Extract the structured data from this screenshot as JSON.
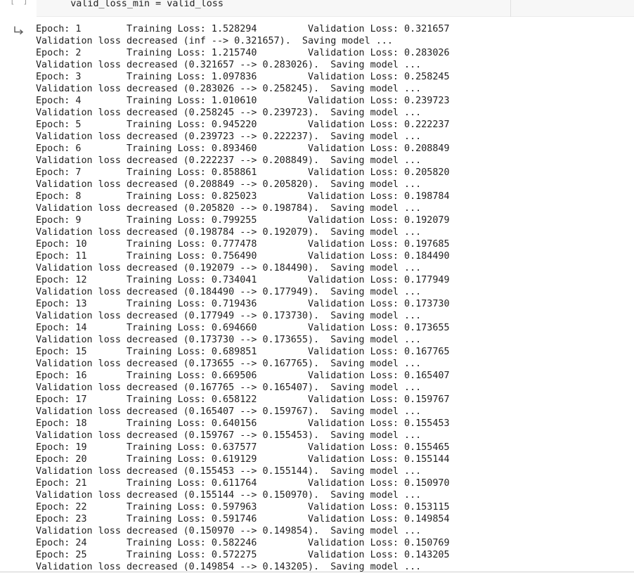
{
  "code_cell": {
    "prompt": "[ ]",
    "code_line": "    valid_loss_min = valid_loss"
  },
  "output": {
    "icon": "output-arrow-icon",
    "lines": [
      "Epoch: 1 \tTraining Loss: 1.528294 \tValidation Loss: 0.321657",
      "Validation loss decreased (inf --> 0.321657).  Saving model ...",
      "Epoch: 2 \tTraining Loss: 1.215740 \tValidation Loss: 0.283026",
      "Validation loss decreased (0.321657 --> 0.283026).  Saving model ...",
      "Epoch: 3 \tTraining Loss: 1.097836 \tValidation Loss: 0.258245",
      "Validation loss decreased (0.283026 --> 0.258245).  Saving model ...",
      "Epoch: 4 \tTraining Loss: 1.010610 \tValidation Loss: 0.239723",
      "Validation loss decreased (0.258245 --> 0.239723).  Saving model ...",
      "Epoch: 5 \tTraining Loss: 0.945220 \tValidation Loss: 0.222237",
      "Validation loss decreased (0.239723 --> 0.222237).  Saving model ...",
      "Epoch: 6 \tTraining Loss: 0.893460 \tValidation Loss: 0.208849",
      "Validation loss decreased (0.222237 --> 0.208849).  Saving model ...",
      "Epoch: 7 \tTraining Loss: 0.858861 \tValidation Loss: 0.205820",
      "Validation loss decreased (0.208849 --> 0.205820).  Saving model ...",
      "Epoch: 8 \tTraining Loss: 0.825023 \tValidation Loss: 0.198784",
      "Validation loss decreased (0.205820 --> 0.198784).  Saving model ...",
      "Epoch: 9 \tTraining Loss: 0.799255 \tValidation Loss: 0.192079",
      "Validation loss decreased (0.198784 --> 0.192079).  Saving model ...",
      "Epoch: 10 \tTraining Loss: 0.777478 \tValidation Loss: 0.197685",
      "Epoch: 11 \tTraining Loss: 0.756490 \tValidation Loss: 0.184490",
      "Validation loss decreased (0.192079 --> 0.184490).  Saving model ...",
      "Epoch: 12 \tTraining Loss: 0.734041 \tValidation Loss: 0.177949",
      "Validation loss decreased (0.184490 --> 0.177949).  Saving model ...",
      "Epoch: 13 \tTraining Loss: 0.719436 \tValidation Loss: 0.173730",
      "Validation loss decreased (0.177949 --> 0.173730).  Saving model ...",
      "Epoch: 14 \tTraining Loss: 0.694660 \tValidation Loss: 0.173655",
      "Validation loss decreased (0.173730 --> 0.173655).  Saving model ...",
      "Epoch: 15 \tTraining Loss: 0.689851 \tValidation Loss: 0.167765",
      "Validation loss decreased (0.173655 --> 0.167765).  Saving model ...",
      "Epoch: 16 \tTraining Loss: 0.669506 \tValidation Loss: 0.165407",
      "Validation loss decreased (0.167765 --> 0.165407).  Saving model ...",
      "Epoch: 17 \tTraining Loss: 0.658122 \tValidation Loss: 0.159767",
      "Validation loss decreased (0.165407 --> 0.159767).  Saving model ...",
      "Epoch: 18 \tTraining Loss: 0.640156 \tValidation Loss: 0.155453",
      "Validation loss decreased (0.159767 --> 0.155453).  Saving model ...",
      "Epoch: 19 \tTraining Loss: 0.637577 \tValidation Loss: 0.155465",
      "Epoch: 20 \tTraining Loss: 0.619129 \tValidation Loss: 0.155144",
      "Validation loss decreased (0.155453 --> 0.155144).  Saving model ...",
      "Epoch: 21 \tTraining Loss: 0.611764 \tValidation Loss: 0.150970",
      "Validation loss decreased (0.155144 --> 0.150970).  Saving model ...",
      "Epoch: 22 \tTraining Loss: 0.597963 \tValidation Loss: 0.153115",
      "Epoch: 23 \tTraining Loss: 0.591746 \tValidation Loss: 0.149854",
      "Validation loss decreased (0.150970 --> 0.149854).  Saving model ...",
      "Epoch: 24 \tTraining Loss: 0.582246 \tValidation Loss: 0.150769",
      "Epoch: 25 \tTraining Loss: 0.572275 \tValidation Loss: 0.143205",
      "Validation loss decreased (0.149854 --> 0.143205).  Saving model ..."
    ]
  }
}
